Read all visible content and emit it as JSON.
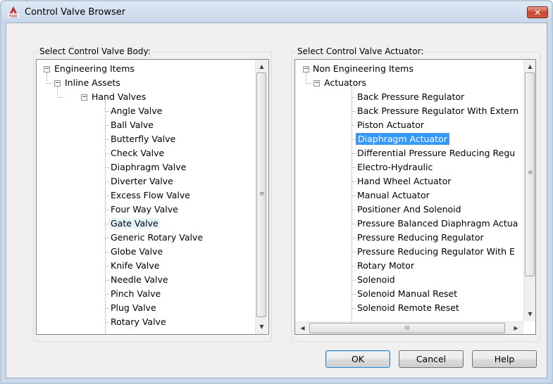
{
  "window": {
    "title": "Control Valve Browser",
    "close_glyph": "✕"
  },
  "body_panel": {
    "label": "Select Control Valve Body:",
    "root": "Engineering Items",
    "level1": "Inline Assets",
    "level2": "Hand Valves",
    "items": [
      "Angle Valve",
      "Ball Valve",
      "Butterfly Valve",
      "Check Valve",
      "Diaphragm Valve",
      "Diverter Valve",
      "Excess Flow Valve",
      "Four Way Valve",
      "Gate Valve",
      "Generic Rotary Valve",
      "Globe Valve",
      "Knife Valve",
      "Needle Valve",
      "Pinch Valve",
      "Plug Valve",
      "Rotary Valve"
    ],
    "hovered_item": "Gate Valve"
  },
  "actuator_panel": {
    "label": "Select Control Valve Actuator:",
    "root": "Non Engineering Items",
    "level1": "Actuators",
    "items": [
      "Back Pressure Regulator",
      "Back Pressure Regulator With Extern",
      "Piston Actuator",
      "Diaphragm Actuator",
      "Differential Pressure Reducing Regu",
      "Electro-Hydraulic",
      "Hand Wheel Actuator",
      "Manual Actuator",
      "Positioner And Solenoid",
      "Pressure Balanced Diaphragm Actua",
      "Pressure Reducing Regulator",
      "Pressure Reducing Regulator With E",
      "Rotary Motor",
      "Solenoid",
      "Solenoid Manual Reset",
      "Solenoid Remote Reset"
    ],
    "selected_item": "Diaphragm Actuator"
  },
  "buttons": {
    "ok": "OK",
    "cancel": "Cancel",
    "help": "Help"
  },
  "glyphs": {
    "expand_minus": "−",
    "up_arrow": "▲",
    "down_arrow": "▼",
    "left_arrow": "◀",
    "right_arrow": "▶",
    "grip_v": "≡",
    "grip_h": "III"
  },
  "colors": {
    "selection": "#3399ff",
    "close_button": "#c7452c",
    "app_icon": "#c0282d"
  }
}
